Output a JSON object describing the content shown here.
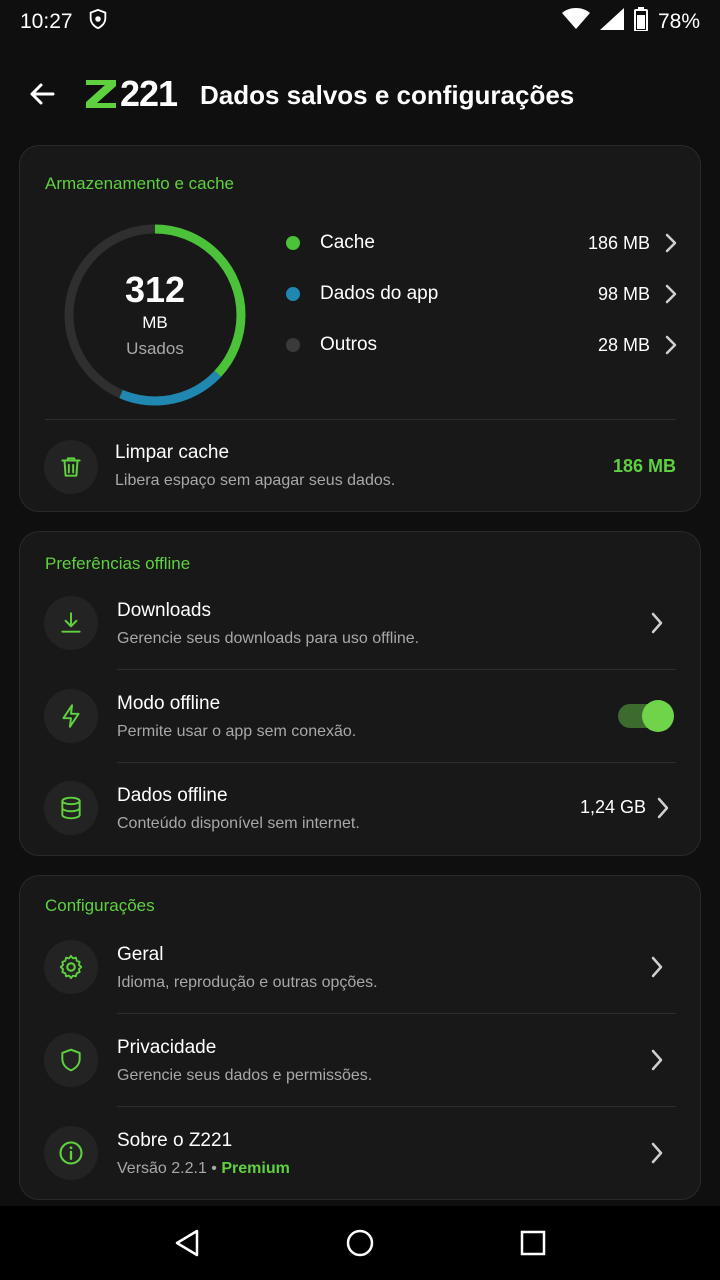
{
  "status_bar": {
    "time": "10:27",
    "battery": "78%"
  },
  "app_bar": {
    "logo_text": "221",
    "title": "Dados salvos e configurações"
  },
  "storage": {
    "section_title": "Armazenamento e cache",
    "total_value": "312",
    "total_unit": "MB",
    "total_label": "Usados",
    "items": [
      {
        "name": "Cache",
        "size": "186 MB",
        "color": "#4cc13a",
        "value_mb": 186
      },
      {
        "name": "Dados do app",
        "size": "98 MB",
        "color": "#1f87b0",
        "value_mb": 98
      },
      {
        "name": "Outros",
        "size": "28 MB",
        "color": "#3a3a3a",
        "value_mb": 28
      }
    ],
    "clear_cache": {
      "title": "Limpar cache",
      "subtitle": "Libera espaço sem apagar seus dados.",
      "value": "186 MB"
    }
  },
  "offline": {
    "section_title": "Preferências offline",
    "downloads": {
      "title": "Downloads",
      "subtitle": "Gerencie seus downloads para uso offline."
    },
    "offline_mode": {
      "title": "Modo offline",
      "subtitle": "Permite usar o app sem conexão.",
      "enabled": true
    },
    "offline_data": {
      "title": "Dados offline",
      "subtitle": "Conteúdo disponível sem internet.",
      "value": "1,24 GB"
    }
  },
  "settings": {
    "section_title": "Configurações",
    "general": {
      "title": "Geral",
      "subtitle": "Idioma, reprodução e outras opções."
    },
    "privacy": {
      "title": "Privacidade",
      "subtitle": "Gerencie seus dados e permissões."
    },
    "about": {
      "title": "Sobre o Z221",
      "version": "Versão 2.2.1",
      "separator": " • ",
      "badge": "Premium"
    }
  },
  "colors": {
    "accent": "#5fd13f",
    "background": "#0f0f0f",
    "card": "#181818"
  }
}
